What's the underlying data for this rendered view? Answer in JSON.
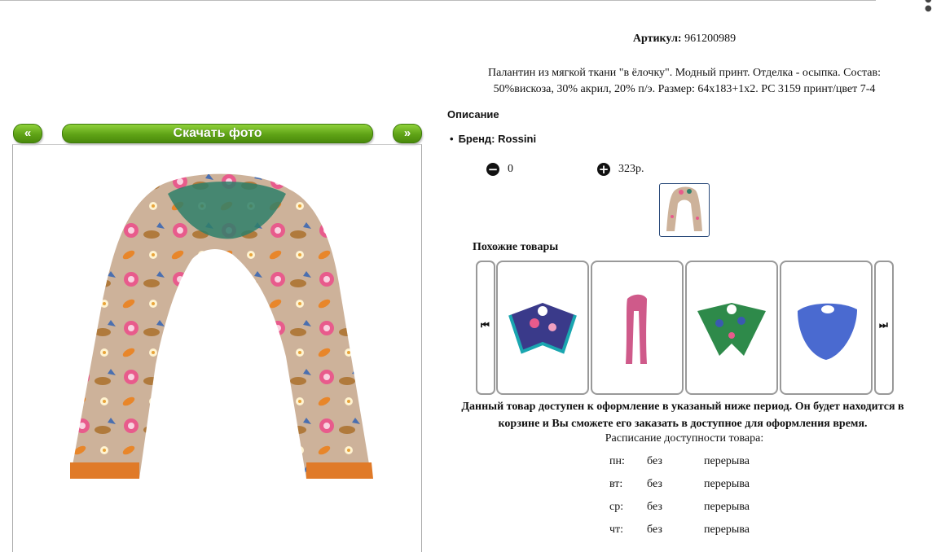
{
  "nav": {
    "prev_label": "«",
    "download_label": "Скачать фото",
    "next_label": "»"
  },
  "product": {
    "article_label": "Артикул:",
    "article_value": "961200989",
    "description_line1": "Палантин из мягкой ткани \"в ёлочку\". Модный принт. Отделка - осыпка. Состав:",
    "description_line2": "50%вискоза, 30% акрил, 20% п/э. Размер: 64x183+1x2. PC 3159 принт/цвет 7-4",
    "section_title": "Описание",
    "brand": "Бренд: Rossini",
    "quantity": "0",
    "price": "323р."
  },
  "similar": {
    "title": "Похожие товары",
    "prev_icon": "skip-previous-icon",
    "next_icon": "skip-next-icon"
  },
  "availability": {
    "line1": "Данный товар доступен к оформление в указаный ниже период. Он будет находится в",
    "line2": "корзине и Вы сможете его заказать в доступное для оформления время.",
    "schedule_title": "Расписание доступности товара:",
    "rows": [
      {
        "day": "пн:",
        "from": "без",
        "to": "перерыва"
      },
      {
        "day": "вт:",
        "from": "без",
        "to": "перерыва"
      },
      {
        "day": "ср:",
        "from": "без",
        "to": "перерыва"
      },
      {
        "day": "чт:",
        "from": "без",
        "to": "перерыва"
      }
    ]
  },
  "colors": {
    "nav_green": "#5fa316",
    "card_border": "#999999",
    "thumb_border": "#2a4a7a"
  }
}
